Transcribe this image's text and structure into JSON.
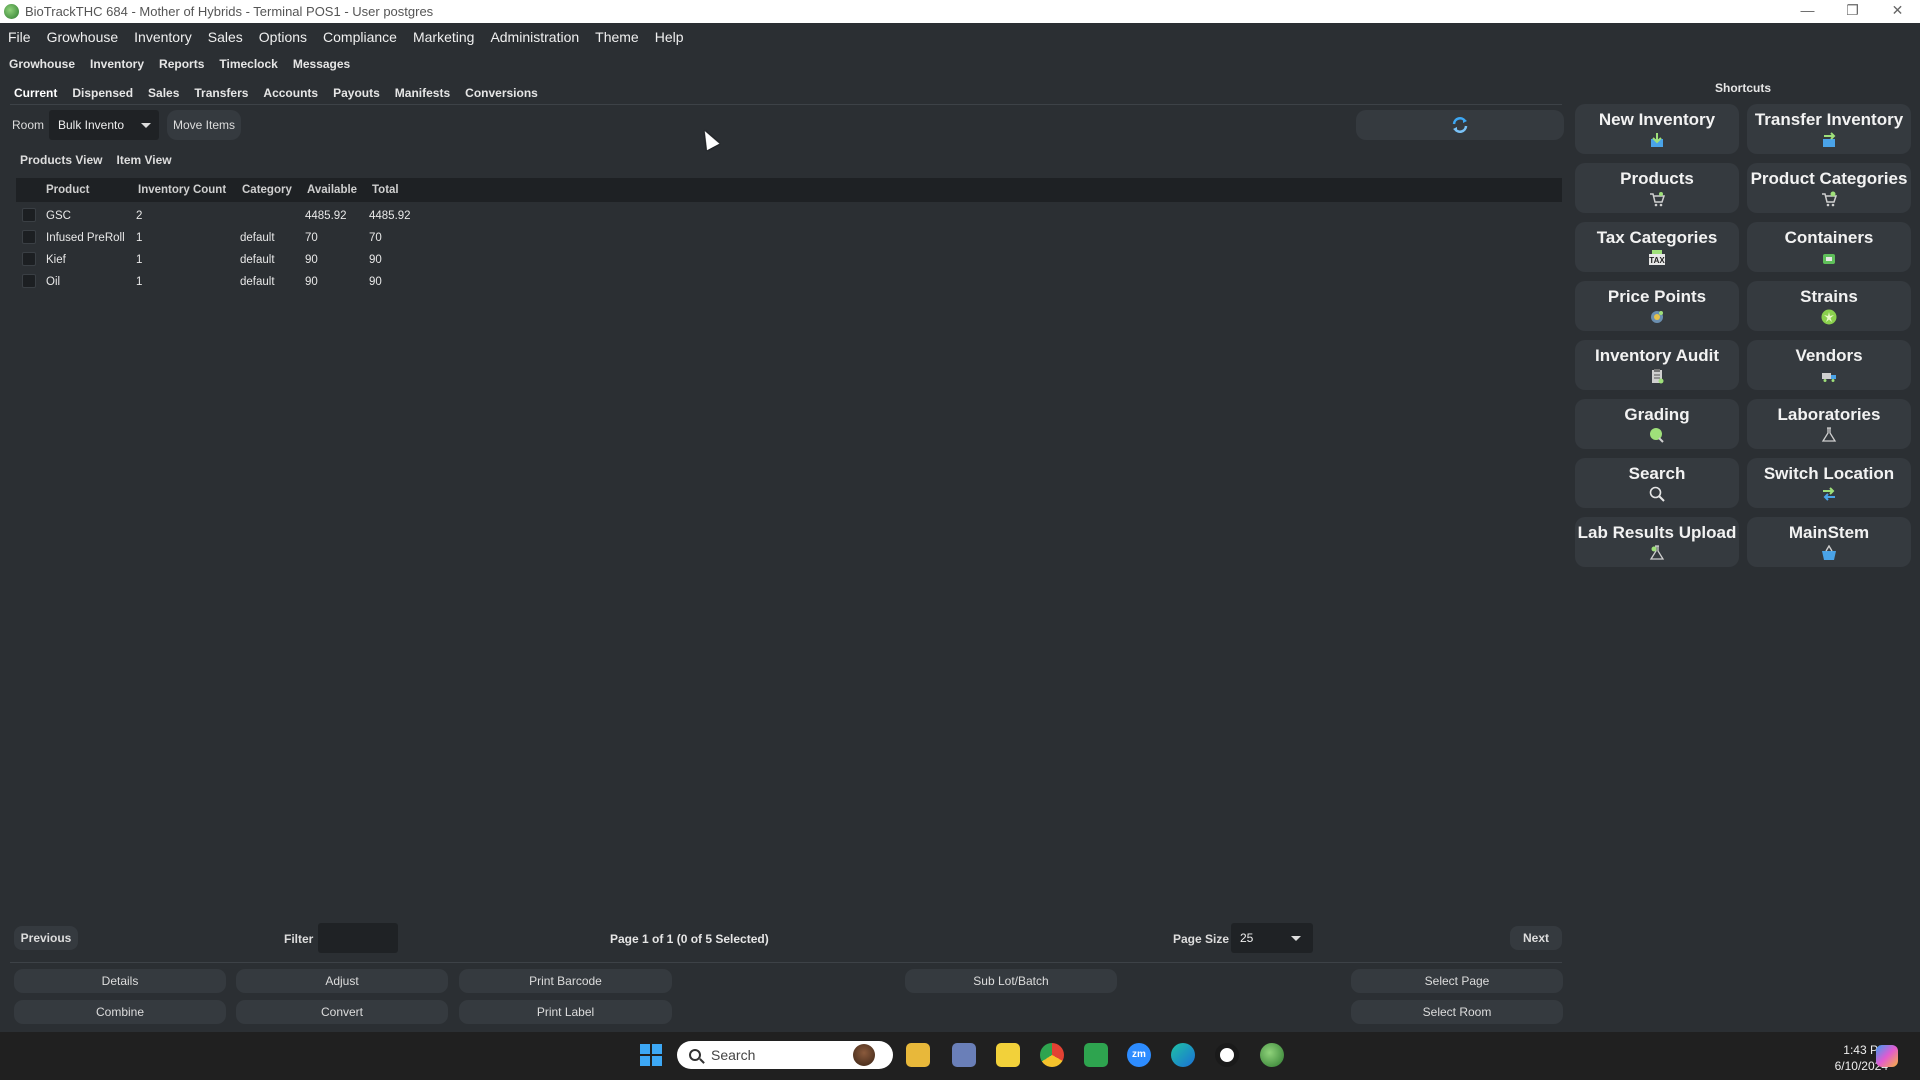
{
  "window": {
    "title": "BioTrackTHC 684 - Mother of Hybrids - Terminal POS1 - User postgres"
  },
  "menu": [
    "File",
    "Growhouse",
    "Inventory",
    "Sales",
    "Options",
    "Compliance",
    "Marketing",
    "Administration",
    "Theme",
    "Help"
  ],
  "top_tabs": [
    "Growhouse",
    "Inventory",
    "Reports",
    "Timeclock",
    "Messages"
  ],
  "sub_tabs": [
    "Current",
    "Dispensed",
    "Sales",
    "Transfers",
    "Accounts",
    "Payouts",
    "Manifests",
    "Conversions"
  ],
  "room": {
    "label": "Room",
    "value": "Bulk Invento",
    "move_label": "Move Items"
  },
  "view_tabs": [
    "Products View",
    "Item View"
  ],
  "table": {
    "columns": [
      "Product",
      "Inventory Count",
      "Category",
      "Available",
      "Total"
    ],
    "rows": [
      {
        "product": "GSC",
        "count": "2",
        "category": "",
        "available": "4485.92",
        "total": "4485.92"
      },
      {
        "product": "Infused PreRoll",
        "count": "1",
        "category": "default",
        "available": "70",
        "total": "70"
      },
      {
        "product": "Kief",
        "count": "1",
        "category": "default",
        "available": "90",
        "total": "90"
      },
      {
        "product": "Oil",
        "count": "1",
        "category": "default",
        "available": "90",
        "total": "90"
      }
    ]
  },
  "pager": {
    "previous": "Previous",
    "filter_label": "Filter",
    "filter_value": "",
    "page_info": "Page 1 of 1 (0 of 5 Selected)",
    "page_size_label": "Page Size",
    "page_size": "25",
    "next": "Next"
  },
  "actions": {
    "details": "Details",
    "adjust": "Adjust",
    "print_barcode": "Print Barcode",
    "sub_lot": "Sub Lot/Batch",
    "select_page": "Select Page",
    "combine": "Combine",
    "convert": "Convert",
    "print_label": "Print Label",
    "select_room": "Select Room"
  },
  "shortcuts": {
    "title": "Shortcuts",
    "items": [
      {
        "label": "New Inventory",
        "icon": "box-download-icon"
      },
      {
        "label": "Transfer Inventory",
        "icon": "transfer-icon"
      },
      {
        "label": "Products",
        "icon": "cart-icon"
      },
      {
        "label": "Product Categories",
        "icon": "cart-add-icon"
      },
      {
        "label": "Tax Categories",
        "icon": "tax-icon"
      },
      {
        "label": "Containers",
        "icon": "container-icon"
      },
      {
        "label": "Price Points",
        "icon": "price-tag-icon"
      },
      {
        "label": "Strains",
        "icon": "leaf-icon"
      },
      {
        "label": "Inventory Audit",
        "icon": "clipboard-icon"
      },
      {
        "label": "Vendors",
        "icon": "truck-icon"
      },
      {
        "label": "Grading",
        "icon": "grade-icon"
      },
      {
        "label": "Laboratories",
        "icon": "flask-icon"
      },
      {
        "label": "Search",
        "icon": "search-icon"
      },
      {
        "label": "Switch Location",
        "icon": "switch-icon"
      },
      {
        "label": "Lab Results Upload",
        "icon": "flask-upload-icon"
      },
      {
        "label": "MainStem",
        "icon": "basket-icon"
      }
    ]
  },
  "taskbar": {
    "search_placeholder": "Search",
    "time": "1:43 PM",
    "date": "6/10/2024",
    "zoom_label": "zm"
  },
  "colors": {
    "background": "#2b2f33",
    "button": "#353a3f",
    "input": "#1f2225",
    "accent_blue": "#3da8f5"
  }
}
